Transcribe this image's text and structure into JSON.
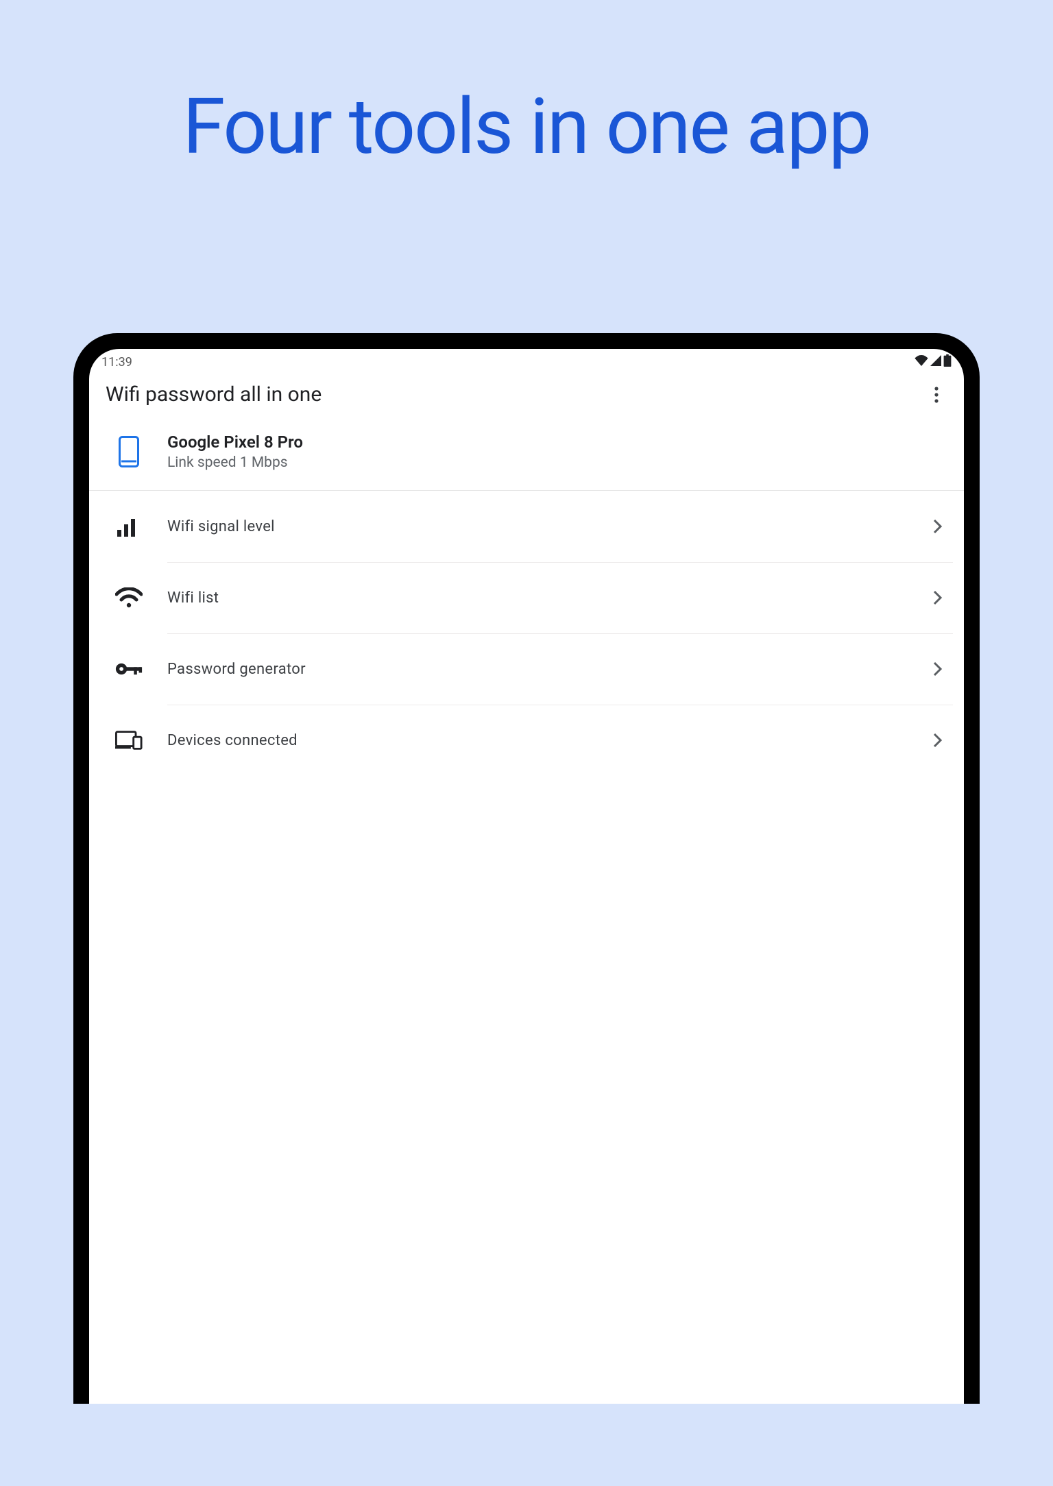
{
  "headline": "Four tools in one app",
  "status": {
    "time": "11:39"
  },
  "titlebar": {
    "title": "Wifi password all in one"
  },
  "device_card": {
    "name": "Google Pixel 8 Pro",
    "sub": "Link speed 1 Mbps"
  },
  "menu": {
    "items": [
      {
        "label": "Wifi signal level"
      },
      {
        "label": "Wifi list"
      },
      {
        "label": "Password generator"
      },
      {
        "label": "Devices connected"
      }
    ]
  },
  "colors": {
    "accent": "#1a56d6"
  }
}
